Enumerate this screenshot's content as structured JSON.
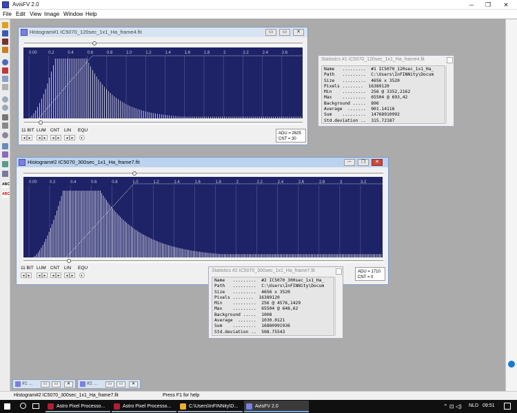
{
  "app": {
    "title": "AvisFV 2.0",
    "min": "─",
    "max": "❐",
    "close": "✕"
  },
  "menu": [
    "File",
    "Edit",
    "View",
    "Image",
    "Window",
    "Help"
  ],
  "hist1": {
    "title": "Histogram#1 IC5070_120sec_1x1_Ha_frame4.fit",
    "ticks": [
      "0.00",
      "0.2",
      "0.4",
      "0.6",
      "0.8",
      "1.0",
      "1.2",
      "1.4",
      "1.6",
      "1.8",
      "2",
      "2.2",
      "2.4",
      "2.6"
    ],
    "controls": [
      "11 BIT",
      "LUM",
      "CNT",
      "LIN",
      "EQU"
    ],
    "adu": "ADU = 2625",
    "cnt": "CNT = 30"
  },
  "hist2": {
    "title": "Histogram#2 IC5070_300sec_1x1_Ha_frame7.fit",
    "ticks": [
      "0.00",
      "0.2",
      "0.4",
      "0.6",
      "0.8",
      "1.0",
      "1.2",
      "1.4",
      "1.6",
      "1.8",
      "2",
      "2.2",
      "2.4",
      "2.6",
      "2.8",
      "3",
      "3.2"
    ],
    "controls": [
      "11 BIT",
      "LUM",
      "CNT",
      "LIN",
      "EQU"
    ],
    "adu": "ADU = 1710",
    "cnt": "CNT = 0"
  },
  "stats1": {
    "title": "Statistics #1 IC5070_120sec_1x1_Ha_frame4.fit",
    "rows": [
      "Name   .........  #1 IC5070_120sec_1x1_Ha_",
      "Path   .........  C:\\Users\\InFINNity\\Docum",
      "Size   .........  4656 x 3520",
      "Pixels ........  16389120",
      "Min    .........  256 @ 3352,2162",
      "Max    .........  65504 @ 693,42",
      "Background .....  896",
      "Average  .......  901.14118",
      "Sum    .........  14768910992",
      "Std.deviation ..  315.72187"
    ]
  },
  "stats2": {
    "title": "Statistics #2 IC5070_300sec_1x1_Ha_frame7.fit",
    "rows": [
      "Name   .........  #2 IC5070_300sec_1x1_Ha_",
      "Path   .........  C:\\Users\\InFINNity\\Docum",
      "Size   .........  4656 x 3520",
      "Pixels ........  16389120",
      "Min    .........  256 @ 4576,1429",
      "Max    .........  65504 @ 648,62",
      "Background .....  1008",
      "Average  .......  1030.0121",
      "Sum    .........  16880991936",
      "Std.deviation ..  508.75543"
    ]
  },
  "minimized": [
    "#1 ...",
    "#2 ..."
  ],
  "status": {
    "left": "Histogram#2 IC5070_300sec_1x1_Ha_frame7.fit",
    "right": "Press F1 for help"
  },
  "taskbar": {
    "tasks": [
      "Astro Pixel Processo...",
      "Astro Pixel Processo...",
      "C:\\Users\\InFINNity\\D...",
      "AvisFV 2.0"
    ],
    "lang": "NLD",
    "time": "09:51"
  },
  "colors": {
    "plot_bg": "#1e2266",
    "bars": "#e8e8f4",
    "accent": "#3a46b8"
  }
}
